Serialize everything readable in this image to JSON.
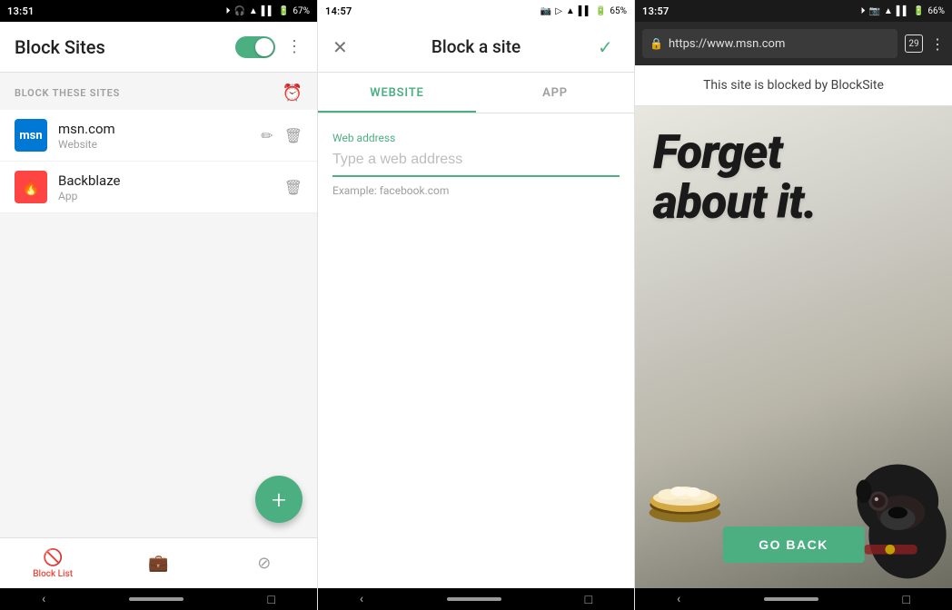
{
  "panel1": {
    "status_time": "13:51",
    "status_battery": "67%",
    "title": "Block Sites",
    "section_label": "BLOCK THESE SITES",
    "sites": [
      {
        "name": "msn.com",
        "type": "Website",
        "icon_label": "msn"
      },
      {
        "name": "Backblaze",
        "type": "App",
        "icon_label": "bb"
      }
    ],
    "fab_label": "+",
    "nav_items": [
      {
        "label": "Block List",
        "active": true
      },
      {
        "label": "",
        "active": false
      },
      {
        "label": "",
        "active": false
      }
    ]
  },
  "panel2": {
    "status_time": "14:57",
    "status_battery": "65%",
    "title": "Block a site",
    "tabs": [
      {
        "label": "WEBSITE",
        "active": true
      },
      {
        "label": "APP",
        "active": false
      }
    ],
    "field_label": "Web address",
    "field_placeholder": "Type a web address",
    "field_hint": "Example: facebook.com"
  },
  "panel3": {
    "status_time": "13:57",
    "status_battery": "66%",
    "url": "https://www.msn.com",
    "tab_count": "29",
    "blocked_notice": "This site is blocked by BlockSite",
    "forget_line1": "Forget",
    "forget_line2": "about it.",
    "go_back_label": "GO BACK"
  }
}
